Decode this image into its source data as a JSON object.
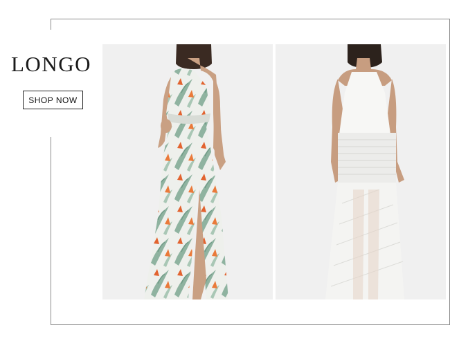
{
  "promo": {
    "title": "LONGO",
    "cta_label": "SHOP NOW"
  },
  "products": [
    {
      "style": "one-shoulder tropical print maxi dress"
    },
    {
      "style": "white halter maxi dress with sheer skirt"
    }
  ],
  "colors": {
    "frame": "#8a8a8a",
    "panel_bg": "#f0f0f0",
    "text": "#1a1a1a"
  }
}
